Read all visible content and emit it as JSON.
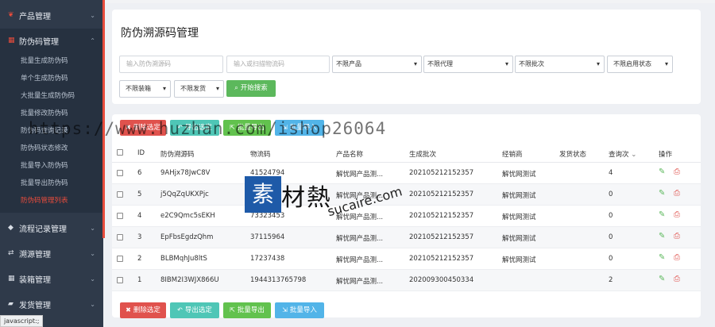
{
  "sidebar": {
    "top_items": [
      {
        "label": "产品管理",
        "icon": "leaf-icon"
      },
      {
        "label": "防伪码管理",
        "icon": "grid-icon"
      }
    ],
    "sub_items": [
      "批量生成防伪码",
      "单个生成防伪码",
      "大批量生成防伪码",
      "批量修改防伪码",
      "防伪码查询记录",
      "防伪码状态修改",
      "批量导入防伪码",
      "批量导出防伪码",
      "防伪码管理列表"
    ],
    "bottom_items": [
      {
        "label": "流程记录管理",
        "icon": "tag-icon"
      },
      {
        "label": "溯源管理",
        "icon": "refresh-icon"
      },
      {
        "label": "装箱管理",
        "icon": "grid-icon"
      },
      {
        "label": "发货管理",
        "icon": "truck-icon"
      }
    ]
  },
  "page": {
    "title": "防伪溯源码管理"
  },
  "filters": {
    "code_placeholder": "输入防伪溯源码",
    "logistics_placeholder": "输入或扫描物流码",
    "product": "不限产品",
    "agent": "不限代理",
    "batch": "不限批次",
    "enable_status": "不限启用状态",
    "packing": "不限装箱",
    "shipping": "不限发货",
    "search_label": "开始搜索"
  },
  "actions": {
    "delete_label": "删除选定",
    "export_selected_label": "导出选定",
    "batch_export_label": "批量导出",
    "batch_import_label": "批量导入"
  },
  "table": {
    "headers": [
      "ID",
      "防伪溯源码",
      "物流码",
      "产品名称",
      "生成批次",
      "经销商",
      "发货状态",
      "查询次",
      "操作"
    ],
    "sort_indicator": "⌄",
    "rows": [
      {
        "id": "6",
        "code": "9AHjx78JwC8V",
        "logistics": "41524794",
        "product": "解忧网产品测...",
        "batch": "20210521215235​7",
        "dealer": "解忧网测试",
        "ship": "",
        "queries": "4"
      },
      {
        "id": "5",
        "code": "j5QqZqUKXPjc",
        "logistics": "",
        "product": "解忧网产品测...",
        "batch": "202105212152357",
        "dealer": "解忧网测试",
        "ship": "",
        "queries": "0"
      },
      {
        "id": "4",
        "code": "e2C9Qmc5sEKH",
        "logistics": "73323453",
        "product": "解忧网产品测...",
        "batch": "202105212152357",
        "dealer": "解忧网测试",
        "ship": "",
        "queries": "0"
      },
      {
        "id": "3",
        "code": "EpFbsEgdzQhm",
        "logistics": "37115964",
        "product": "解忧网产品测...",
        "batch": "202105212152357",
        "dealer": "解忧网测试",
        "ship": "",
        "queries": "0"
      },
      {
        "id": "2",
        "code": "BLBMqhJu8ltS",
        "logistics": "17237438",
        "product": "解忧网产品测...",
        "batch": "202105212152357",
        "dealer": "解忧网测试",
        "ship": "",
        "queries": "0"
      },
      {
        "id": "1",
        "code": "8IBM2I3WJX866U",
        "logistics": "1944313765798",
        "product": "解忧网产品测...",
        "batch": "202009300450334",
        "dealer": "",
        "ship": "",
        "queries": "2"
      }
    ]
  },
  "watermark": {
    "url": "https://www.huzhan.com/ishop26064",
    "logo_box": "素",
    "logo_text": "材熱",
    "logo_sub": "sucaire.com"
  },
  "status_bar": "javascript:;",
  "colors": {
    "sidebar": "#2f3a4a",
    "accent_red": "#e74c3c",
    "search_green": "#5cb85c",
    "teal": "#4fc6b6",
    "blue": "#52b4e8"
  }
}
